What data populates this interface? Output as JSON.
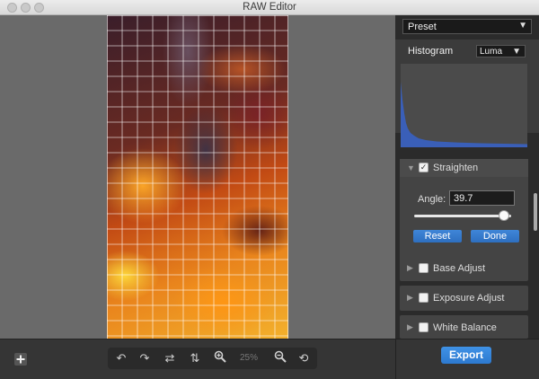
{
  "window": {
    "title": "RAW Editor"
  },
  "panel": {
    "preset": {
      "label": "Preset"
    },
    "histogram": {
      "label": "Histogram",
      "mode": "Luma"
    },
    "straighten": {
      "label": "Straighten",
      "enabled": true,
      "angle_label": "Angle:",
      "angle_value": "39.7",
      "angle_slider_fraction": 0.93,
      "reset_label": "Reset",
      "done_label": "Done"
    },
    "sections": [
      {
        "label": "Base Adjust",
        "enabled": false
      },
      {
        "label": "Exposure Adjust",
        "enabled": false
      },
      {
        "label": "White Balance",
        "enabled": false
      }
    ]
  },
  "toolbar": {
    "zoom_level": "25%",
    "export_label": "Export"
  },
  "colors": {
    "accent": "#2e6fc0",
    "export": "#2d79cf",
    "histogram_fill": "#3a5fb8"
  }
}
